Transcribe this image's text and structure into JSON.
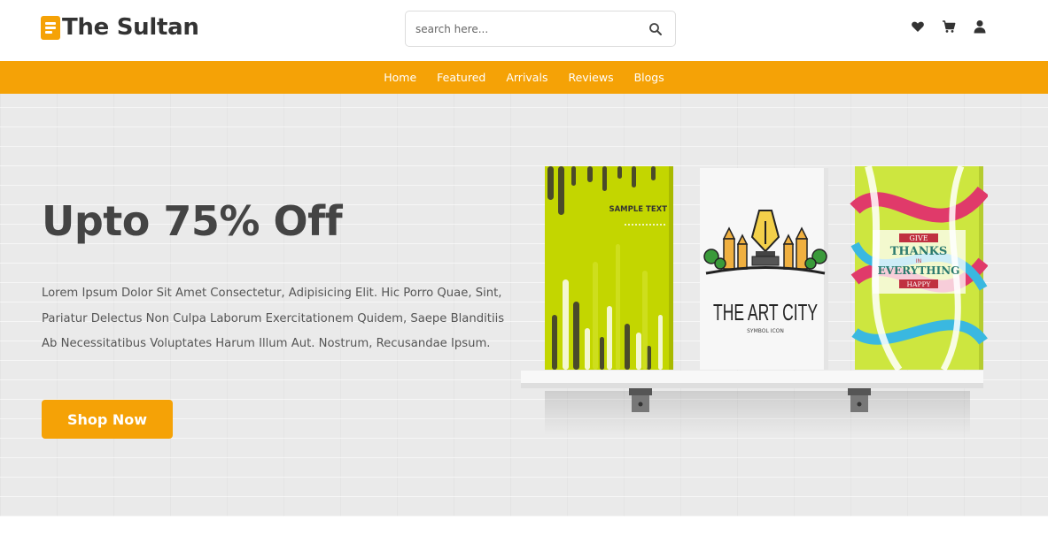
{
  "header": {
    "logo_text": "The Sultan",
    "search_placeholder": "search here...",
    "icons": [
      "heart-icon",
      "cart-icon",
      "user-icon"
    ]
  },
  "nav": {
    "items": [
      {
        "label": "Home"
      },
      {
        "label": "Featured"
      },
      {
        "label": "Arrivals"
      },
      {
        "label": "Reviews"
      },
      {
        "label": "Blogs"
      }
    ]
  },
  "hero": {
    "title": "Upto 75% Off",
    "text": "Lorem Ipsum Dolor Sit Amet Consectetur, Adipisicing Elit. Hic Porro Quae, Sint, Pariatur Delectus Non Culpa Laborum Exercitationem Quidem, Saepe Blanditiis Ab Necessitatibus Voluptates Harum Illum Aut. Nostrum, Recusandae Ipsum.",
    "button_label": "Shop Now"
  },
  "books": [
    {
      "cover_text": "SAMPLE TEXT"
    },
    {
      "title": "THE ART CITY",
      "subtitle": "SYMBOL ICON"
    },
    {
      "line1": "GIVE",
      "line2": "THANKS",
      "line3": "IN",
      "line4": "EVERYTHING",
      "line5": "HAPPY"
    }
  ],
  "colors": {
    "accent": "#f5a206",
    "text_dark": "#444444",
    "hero_bg": "#eaeaea"
  }
}
